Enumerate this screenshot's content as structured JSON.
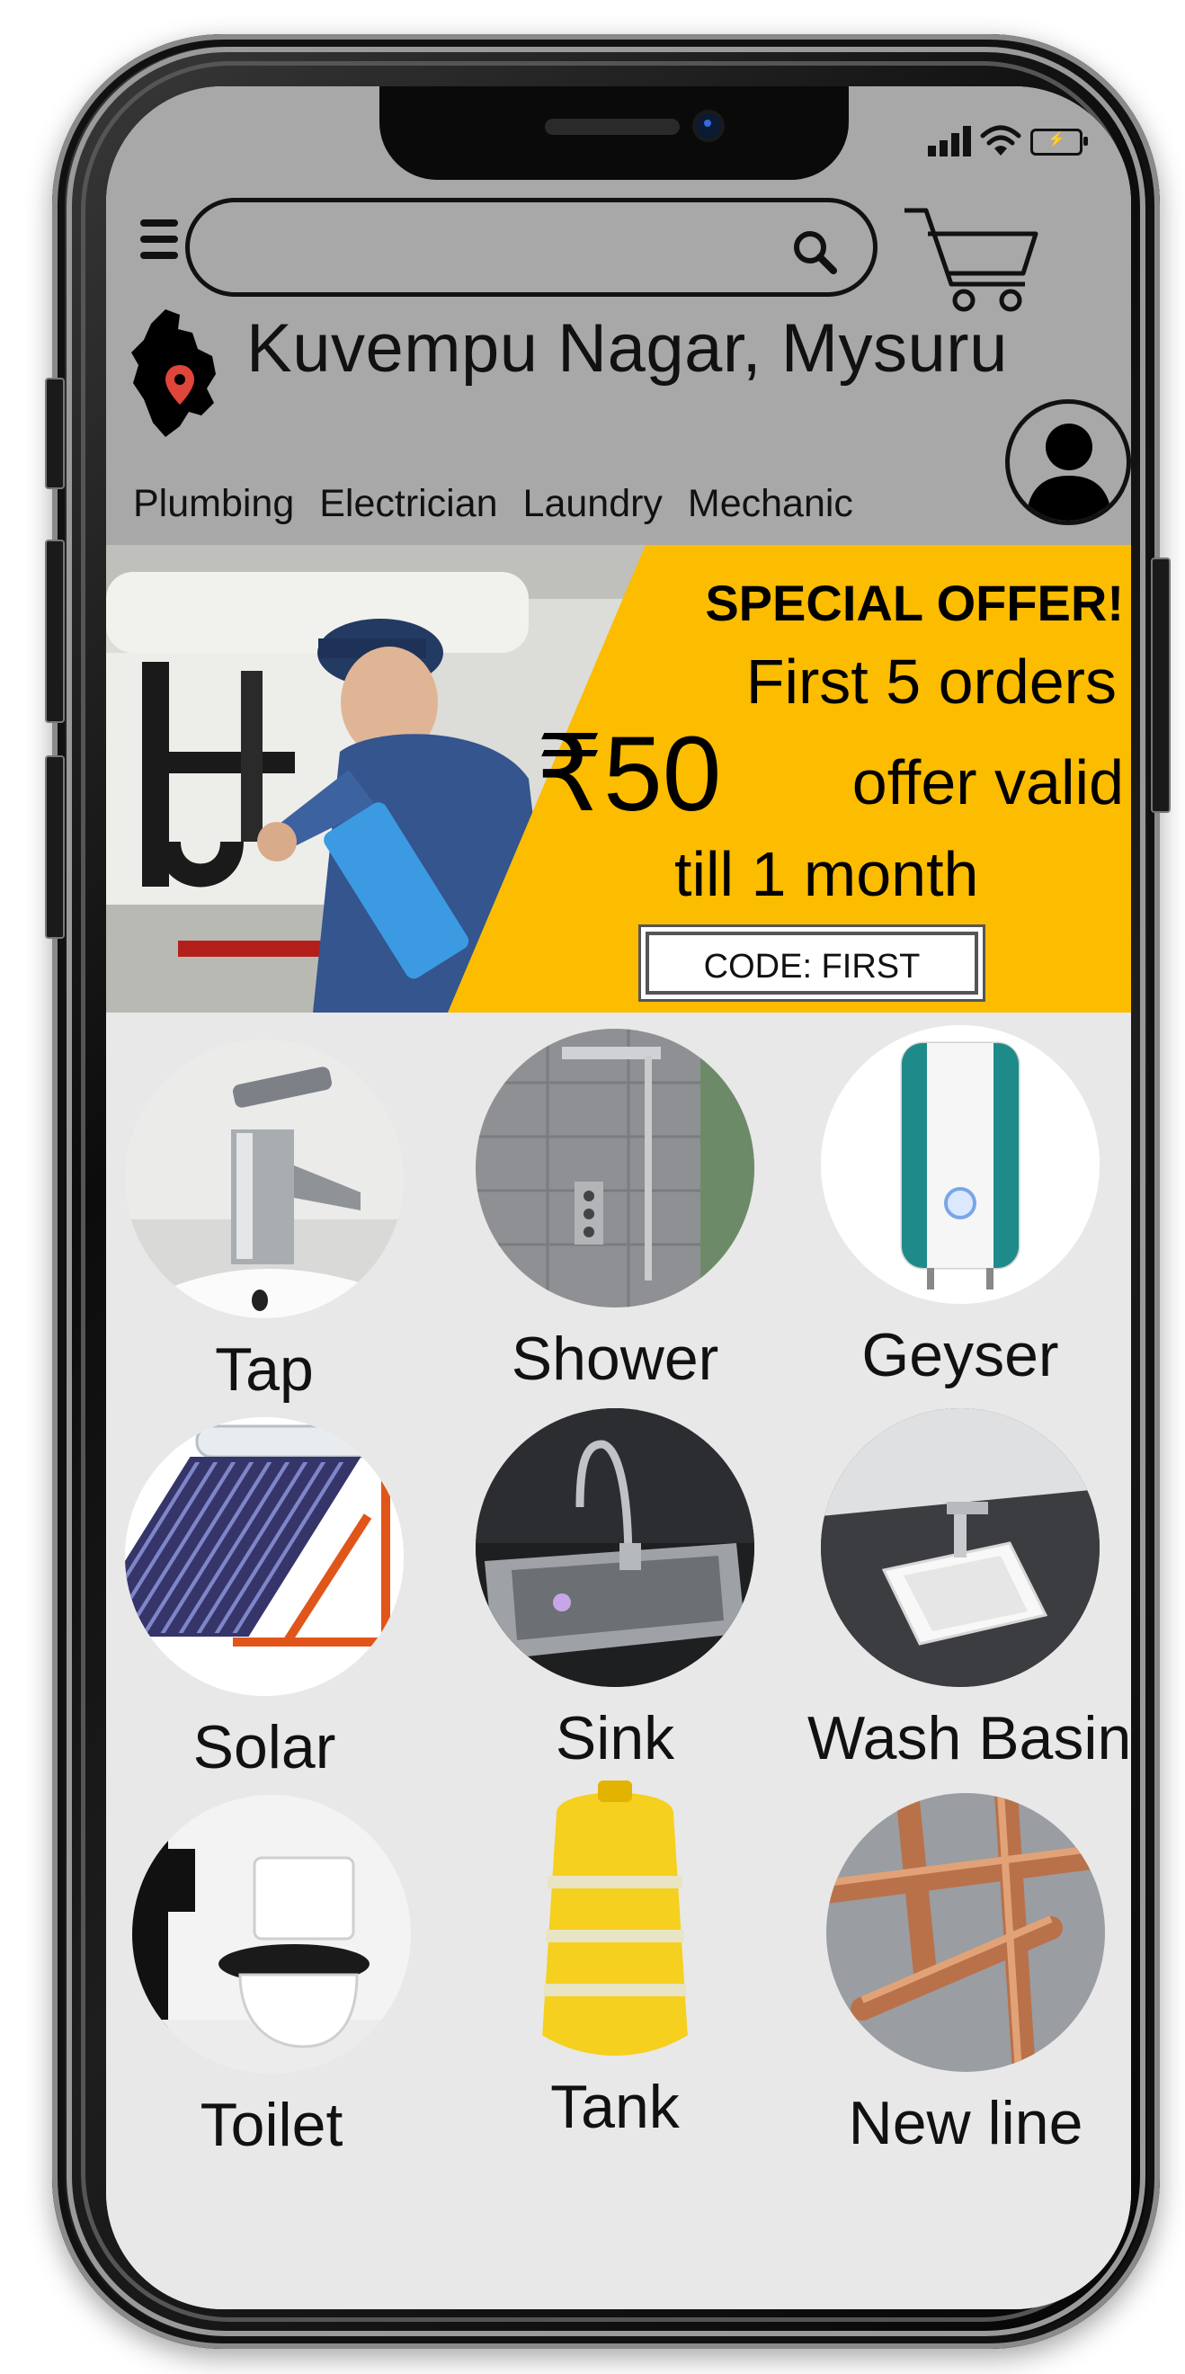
{
  "header": {
    "location": "Kuvempu Nagar, Mysuru",
    "search": {
      "value": "",
      "placeholder": ""
    }
  },
  "categories": [
    "Plumbing",
    "Electrician",
    "Laundry",
    "Mechanic"
  ],
  "banner": {
    "title": "SPECIAL OFFER!",
    "line1": "First 5 orders",
    "amount": "₹50",
    "line2": "offer valid",
    "line3": "till 1 month",
    "code": "CODE: FIRST"
  },
  "products": [
    {
      "label": "Tap",
      "icon": "tap-image"
    },
    {
      "label": "Shower",
      "icon": "shower-image"
    },
    {
      "label": "Geyser",
      "icon": "geyser-image"
    },
    {
      "label": "Solar",
      "icon": "solar-image"
    },
    {
      "label": "Sink",
      "icon": "sink-image"
    },
    {
      "label": "Wash Basin",
      "icon": "wash-basin-image"
    },
    {
      "label": "Toilet",
      "icon": "toilet-image"
    },
    {
      "label": "Tank",
      "icon": "tank-image"
    },
    {
      "label": "New line",
      "icon": "pipe-image"
    }
  ],
  "colors": {
    "header_bg": "#a8a8a8",
    "offer_bg": "#fcbc00",
    "screen_bg": "#e8e8e8"
  }
}
